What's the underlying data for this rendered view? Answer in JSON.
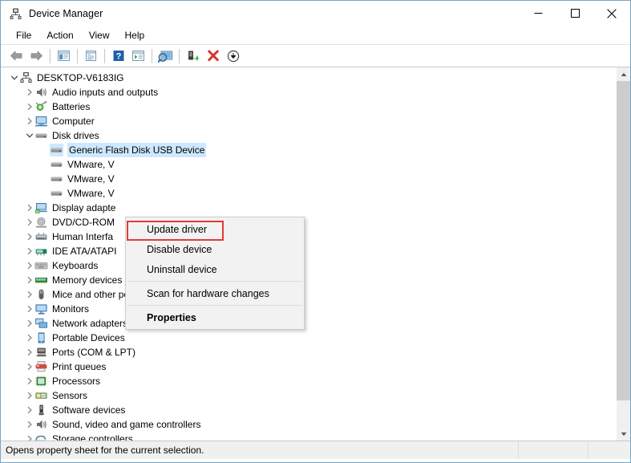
{
  "window": {
    "title": "Device Manager",
    "title_icon": "device-manager-icon",
    "caption": {
      "minimize": "minimize-icon",
      "maximize": "maximize-icon",
      "close": "close-icon"
    }
  },
  "menubar": {
    "items": [
      "File",
      "Action",
      "View",
      "Help"
    ]
  },
  "toolbar": {
    "items": [
      {
        "name": "back-icon"
      },
      {
        "name": "forward-icon"
      },
      {
        "name": "separator"
      },
      {
        "name": "show-hide-console-tree-icon"
      },
      {
        "name": "separator"
      },
      {
        "name": "properties-icon"
      },
      {
        "name": "separator"
      },
      {
        "name": "help-icon"
      },
      {
        "name": "update-driver-icon"
      },
      {
        "name": "separator"
      },
      {
        "name": "scan-hardware-changes-icon"
      },
      {
        "name": "separator"
      },
      {
        "name": "enable-device-icon"
      },
      {
        "name": "uninstall-device-icon"
      },
      {
        "name": "install-legacy-hardware-icon"
      }
    ]
  },
  "tree": {
    "nodes": [
      {
        "label": "DESKTOP-V6183IG",
        "depth": 0,
        "state": "expanded",
        "icon": "computer-root-icon",
        "selected": false
      },
      {
        "label": "Audio inputs and outputs",
        "depth": 1,
        "state": "collapsed",
        "icon": "audio-icon",
        "selected": false
      },
      {
        "label": "Batteries",
        "depth": 1,
        "state": "collapsed",
        "icon": "battery-icon",
        "selected": false
      },
      {
        "label": "Computer",
        "depth": 1,
        "state": "collapsed",
        "icon": "computer-icon",
        "selected": false
      },
      {
        "label": "Disk drives",
        "depth": 1,
        "state": "expanded",
        "icon": "disk-drive-icon",
        "selected": false
      },
      {
        "label": "Generic Flash Disk USB Device",
        "depth": 2,
        "state": "leaf",
        "icon": "disk-drive-icon",
        "selected": true
      },
      {
        "label": "VMware, V",
        "depth": 2,
        "state": "leaf",
        "icon": "disk-drive-icon",
        "selected": false
      },
      {
        "label": "VMware, V",
        "depth": 2,
        "state": "leaf",
        "icon": "disk-drive-icon",
        "selected": false
      },
      {
        "label": "VMware, V",
        "depth": 2,
        "state": "leaf",
        "icon": "disk-drive-icon",
        "selected": false
      },
      {
        "label": "Display adapte",
        "depth": 1,
        "state": "collapsed",
        "icon": "display-adapter-icon",
        "selected": false
      },
      {
        "label": "DVD/CD-ROM",
        "depth": 1,
        "state": "collapsed",
        "icon": "dvd-icon",
        "selected": false
      },
      {
        "label": "Human Interfa",
        "depth": 1,
        "state": "collapsed",
        "icon": "hid-icon",
        "selected": false
      },
      {
        "label": "IDE ATA/ATAPI",
        "depth": 1,
        "state": "collapsed",
        "icon": "ide-icon",
        "selected": false
      },
      {
        "label": "Keyboards",
        "depth": 1,
        "state": "collapsed",
        "icon": "keyboard-icon",
        "selected": false
      },
      {
        "label": "Memory devices",
        "depth": 1,
        "state": "collapsed",
        "icon": "memory-icon",
        "selected": false
      },
      {
        "label": "Mice and other pointing devices",
        "depth": 1,
        "state": "collapsed",
        "icon": "mouse-icon",
        "selected": false
      },
      {
        "label": "Monitors",
        "depth": 1,
        "state": "collapsed",
        "icon": "monitor-icon",
        "selected": false
      },
      {
        "label": "Network adapters",
        "depth": 1,
        "state": "collapsed",
        "icon": "network-adapter-icon",
        "selected": false
      },
      {
        "label": "Portable Devices",
        "depth": 1,
        "state": "collapsed",
        "icon": "portable-device-icon",
        "selected": false
      },
      {
        "label": "Ports (COM & LPT)",
        "depth": 1,
        "state": "collapsed",
        "icon": "port-icon",
        "selected": false
      },
      {
        "label": "Print queues",
        "depth": 1,
        "state": "collapsed",
        "icon": "printer-icon",
        "selected": false
      },
      {
        "label": "Processors",
        "depth": 1,
        "state": "collapsed",
        "icon": "processor-icon",
        "selected": false
      },
      {
        "label": "Sensors",
        "depth": 1,
        "state": "collapsed",
        "icon": "sensor-icon",
        "selected": false
      },
      {
        "label": "Software devices",
        "depth": 1,
        "state": "collapsed",
        "icon": "software-device-icon",
        "selected": false
      },
      {
        "label": "Sound, video and game controllers",
        "depth": 1,
        "state": "collapsed",
        "icon": "sound-icon",
        "selected": false
      },
      {
        "label": "Storage controllers",
        "depth": 1,
        "state": "collapsed",
        "icon": "storage-controller-icon",
        "selected": false
      }
    ]
  },
  "context_menu": {
    "items": [
      {
        "label": "Update driver",
        "type": "item",
        "bold": false,
        "highlighted": true
      },
      {
        "label": "Disable device",
        "type": "item",
        "bold": false,
        "highlighted": false
      },
      {
        "label": "Uninstall device",
        "type": "item",
        "bold": false,
        "highlighted": false
      },
      {
        "type": "separator"
      },
      {
        "label": "Scan for hardware changes",
        "type": "item",
        "bold": false,
        "highlighted": false
      },
      {
        "type": "separator"
      },
      {
        "label": "Properties",
        "type": "item",
        "bold": true,
        "highlighted": false
      }
    ],
    "highlight_color": "#e23c35"
  },
  "statusbar": {
    "text": "Opens property sheet for the current selection."
  },
  "colors": {
    "selection": "#cde8ff",
    "window_border": "#7aa5bd",
    "menu_bg": "#f2f2f2",
    "status_bg": "#f0f0f0",
    "scrollbar_thumb": "#cdcdcd"
  }
}
